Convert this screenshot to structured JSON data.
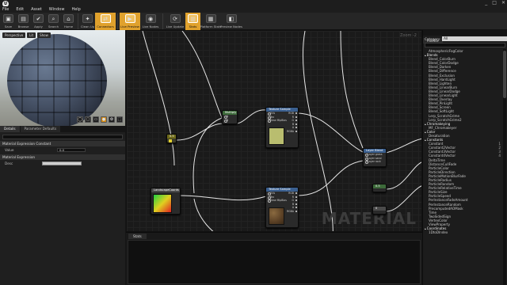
{
  "menu": [
    "File",
    "Edit",
    "Asset",
    "Window",
    "Help"
  ],
  "window_controls": [
    "_",
    "□",
    "✕"
  ],
  "toolbar": [
    {
      "label": "Save",
      "icon": "save-icon",
      "glyph": "▣",
      "state": ""
    },
    {
      "label": "Browse",
      "icon": "browse-icon",
      "glyph": "▤",
      "state": ""
    },
    {
      "label": "Apply",
      "icon": "apply-icon",
      "glyph": "✔",
      "state": ""
    },
    {
      "label": "Search",
      "icon": "search-icon",
      "glyph": "⌕",
      "state": ""
    },
    {
      "label": "Home",
      "icon": "home-icon",
      "glyph": "⌂",
      "state": ""
    },
    {
      "label": "Clean Up",
      "icon": "clean-up-icon",
      "glyph": "✦",
      "state": ""
    },
    {
      "label": "Connectors",
      "icon": "connectors-icon",
      "glyph": "⇄",
      "state": "active"
    },
    {
      "label": "Live Preview",
      "icon": "live-preview-icon",
      "glyph": "▶",
      "state": "active"
    },
    {
      "label": "Live Nodes",
      "icon": "live-nodes-icon",
      "glyph": "◉",
      "state": ""
    },
    {
      "label": "Live Update",
      "icon": "live-update-icon",
      "glyph": "⟳",
      "state": ""
    },
    {
      "label": "Stats",
      "icon": "stats-icon",
      "glyph": "▥",
      "state": "active"
    },
    {
      "label": "Platform Stats",
      "icon": "platform-stats-icon",
      "glyph": "▦",
      "state": ""
    },
    {
      "label": "Preview Nodes",
      "icon": "preview-nodes-icon",
      "glyph": "◧",
      "state": ""
    }
  ],
  "viewport": {
    "tabs": [
      "Perspective",
      "Lit",
      "Show"
    ],
    "shapes": [
      "◯",
      "▢",
      "▭",
      "●",
      "✿",
      "⬚"
    ]
  },
  "details": {
    "tabs": [
      "Details",
      "Parameter Defaults"
    ],
    "section1": "Material Expression Constant",
    "row1_label": "Value",
    "row1_value": "0.0",
    "section2": "Material Expression",
    "row2_label": "Desc"
  },
  "graph": {
    "zoom": "Zoom -2",
    "watermark": "MATERIAL"
  },
  "nodes": {
    "constant": {
      "title": "0.5"
    },
    "multiply": {
      "title": "Multiply",
      "pins": [
        "A",
        "B"
      ]
    },
    "tex1": {
      "title": "Texture Sample",
      "pins": [
        "UVs",
        "Tex",
        "View MipBias"
      ],
      "outs": [
        "RGB",
        "R",
        "G",
        "B",
        "A",
        "RGBA"
      ]
    },
    "tex2": {
      "title": "Texture Sample",
      "pins": [
        "UVs",
        "Tex",
        "View MipBias"
      ],
      "outs": [
        "RGB",
        "R",
        "G",
        "B",
        "A",
        "RGBA"
      ]
    },
    "coords": {
      "title": "LandscapeCoords"
    },
    "lerp": {
      "title": "Layer Blend",
      "pins": [
        "Layer grass",
        "Layer sand",
        "Layer rock"
      ]
    },
    "c2": {
      "title": "0.5"
    },
    "c3": {
      "title": "0"
    }
  },
  "output": {
    "tab": "Stats"
  },
  "palette": {
    "tab": "Palette",
    "category_label": "Category",
    "category_value": "All",
    "items": [
      {
        "t": "item",
        "label": "AtmosphericFogColor",
        "key": ""
      },
      {
        "t": "cat",
        "label": "Blends",
        "key": ""
      },
      {
        "t": "item",
        "label": "Blend_ColorBurn",
        "key": ""
      },
      {
        "t": "item",
        "label": "Blend_ColorDodge",
        "key": ""
      },
      {
        "t": "item",
        "label": "Blend_Darken",
        "key": ""
      },
      {
        "t": "item",
        "label": "Blend_Difference",
        "key": ""
      },
      {
        "t": "item",
        "label": "Blend_Exclusion",
        "key": ""
      },
      {
        "t": "item",
        "label": "Blend_HardLight",
        "key": ""
      },
      {
        "t": "item",
        "label": "Blend_Lighten",
        "key": ""
      },
      {
        "t": "item",
        "label": "Blend_LinearBurn",
        "key": ""
      },
      {
        "t": "item",
        "label": "Blend_LinearDodge",
        "key": ""
      },
      {
        "t": "item",
        "label": "Blend_LinearLight",
        "key": ""
      },
      {
        "t": "item",
        "label": "Blend_Overlay",
        "key": ""
      },
      {
        "t": "item",
        "label": "Blend_PinLight",
        "key": ""
      },
      {
        "t": "item",
        "label": "Blend_Screen",
        "key": ""
      },
      {
        "t": "item",
        "label": "Blend_SoftLight",
        "key": ""
      },
      {
        "t": "item",
        "label": "Lerp_ScratchGrime",
        "key": ""
      },
      {
        "t": "item",
        "label": "Lerp_ScratchGrime2",
        "key": ""
      },
      {
        "t": "cat",
        "label": "Chromakeying",
        "key": ""
      },
      {
        "t": "item",
        "label": "MF_Chromakeyer",
        "key": ""
      },
      {
        "t": "cat",
        "label": "Color",
        "key": ""
      },
      {
        "t": "item",
        "label": "Desaturation",
        "key": ""
      },
      {
        "t": "cat",
        "label": "Constants",
        "key": ""
      },
      {
        "t": "item",
        "label": "Constant",
        "key": "1"
      },
      {
        "t": "item",
        "label": "Constant2Vector",
        "key": "2"
      },
      {
        "t": "item",
        "label": "Constant3Vector",
        "key": "3"
      },
      {
        "t": "item",
        "label": "Constant4Vector",
        "key": "4"
      },
      {
        "t": "item",
        "label": "DeltaTime",
        "key": ""
      },
      {
        "t": "item",
        "label": "DistanceCullFade",
        "key": ""
      },
      {
        "t": "item",
        "label": "ParticleColor",
        "key": ""
      },
      {
        "t": "item",
        "label": "ParticleDirection",
        "key": ""
      },
      {
        "t": "item",
        "label": "ParticleMotionBlurFade",
        "key": ""
      },
      {
        "t": "item",
        "label": "ParticleRadius",
        "key": ""
      },
      {
        "t": "item",
        "label": "ParticleRandom",
        "key": ""
      },
      {
        "t": "item",
        "label": "ParticleRelativeTime",
        "key": ""
      },
      {
        "t": "item",
        "label": "ParticleSize",
        "key": ""
      },
      {
        "t": "item",
        "label": "ParticleSpeed",
        "key": ""
      },
      {
        "t": "item",
        "label": "PerInstanceFadeAmount",
        "key": ""
      },
      {
        "t": "item",
        "label": "PerInstanceRandom",
        "key": ""
      },
      {
        "t": "item",
        "label": "PrecomputedAOMask",
        "key": ""
      },
      {
        "t": "item",
        "label": "Time",
        "key": ""
      },
      {
        "t": "item",
        "label": "TwoSidedSign",
        "key": ""
      },
      {
        "t": "item",
        "label": "VertexColor",
        "key": ""
      },
      {
        "t": "item",
        "label": "ViewProperty",
        "key": ""
      },
      {
        "t": "cat",
        "label": "Coordinates",
        "key": ""
      },
      {
        "t": "item",
        "label": "1DtoDIndex",
        "key": ""
      }
    ]
  }
}
